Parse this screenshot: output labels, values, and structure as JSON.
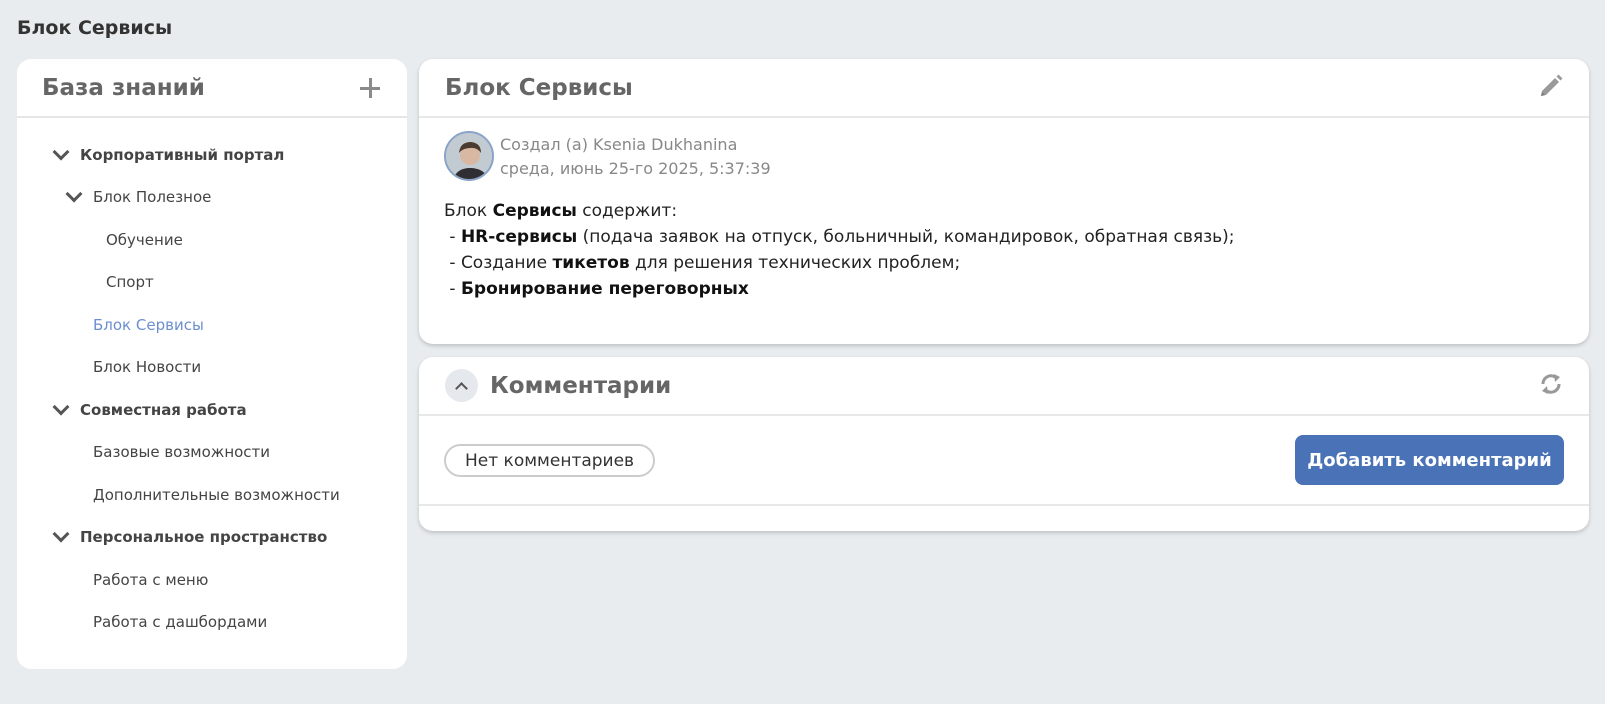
{
  "page": {
    "title": "Блок Сервисы"
  },
  "sidebar": {
    "title": "База знаний",
    "items": [
      {
        "label": "Корпоративный портал",
        "level": 0,
        "expanded": true
      },
      {
        "label": "Блок Полезное",
        "level": 1,
        "expanded": true
      },
      {
        "label": "Обучение",
        "level": 2
      },
      {
        "label": "Спорт",
        "level": 2
      },
      {
        "label": "Блок Сервисы",
        "level": 1,
        "active": true
      },
      {
        "label": "Блок Новости",
        "level": 1
      },
      {
        "label": "Совместная работа",
        "level": 0,
        "expanded": true
      },
      {
        "label": "Базовые возможности",
        "level": 1
      },
      {
        "label": "Дополнительные возможности",
        "level": 1
      },
      {
        "label": "Персональное пространство",
        "level": 0,
        "expanded": true
      },
      {
        "label": "Работа с меню",
        "level": 1
      },
      {
        "label": "Работа с дашбордами",
        "level": 1
      }
    ]
  },
  "article": {
    "title": "Блок Сервисы",
    "author_line": "Создал (а) Ksenia Dukhanina",
    "date_line": "среда, июнь 25-го 2025, 5:37:39",
    "intro_1": "Блок ",
    "intro_bold": "Сервисы",
    "intro_2": " содержит:",
    "line1_prefix": " - ",
    "line1_bold": "HR-сервисы",
    "line1_rest": " (подача заявок на отпуск, больничный, командировок, обратная связь);",
    "line2_prefix": " - Создание ",
    "line2_bold": "тикетов",
    "line2_rest": " для решения технических проблем;",
    "line3_prefix": " - ",
    "line3_bold": "Бронирование переговорных"
  },
  "comments": {
    "title": "Комментарии",
    "empty_label": "Нет комментариев",
    "add_button": "Добавить комментарий"
  },
  "colors": {
    "accent": "#4a72b7",
    "active_link": "#6b8fcf",
    "background": "#e8ecee"
  }
}
